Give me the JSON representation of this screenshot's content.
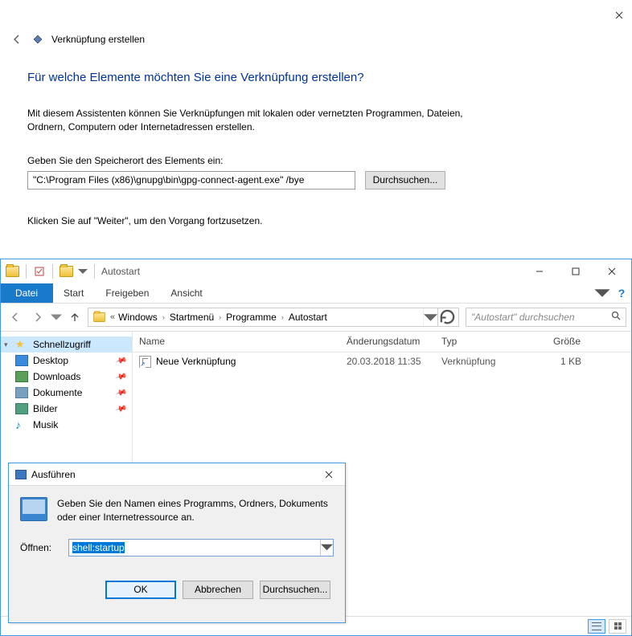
{
  "wizard": {
    "close_tip": "Schließen",
    "title": "Verknüpfung erstellen",
    "heading": "Für welche Elemente möchten Sie eine Verknüpfung erstellen?",
    "intro": "Mit diesem Assistenten können Sie Verknüpfungen mit lokalen oder vernetzten Programmen, Dateien, Ordnern, Computern oder Internetadressen erstellen.",
    "input_label": "Geben Sie den Speicherort des Elements ein:",
    "path_value": "\"C:\\Program Files (x86)\\gnupg\\bin\\gpg-connect-agent.exe\" /bye",
    "browse": "Durchsuchen...",
    "hint": "Klicken Sie auf \"Weiter\", um den Vorgang fortzusetzen."
  },
  "explorer": {
    "caption": "Autostart",
    "ribbon": {
      "file": "Datei",
      "tabs": [
        "Start",
        "Freigeben",
        "Ansicht"
      ],
      "help": "?"
    },
    "breadcrumb": [
      "Windows",
      "Startmenü",
      "Programme",
      "Autostart"
    ],
    "search_placeholder": "\"Autostart\" durchsuchen",
    "sidebar": {
      "items": [
        {
          "label": "Schnellzugriff",
          "icon": "star",
          "selected": true
        },
        {
          "label": "Desktop",
          "icon": "desk",
          "pinned": true
        },
        {
          "label": "Downloads",
          "icon": "dl",
          "pinned": true
        },
        {
          "label": "Dokumente",
          "icon": "doc",
          "pinned": true
        },
        {
          "label": "Bilder",
          "icon": "pic",
          "pinned": true
        },
        {
          "label": "Musik",
          "icon": "music"
        }
      ]
    },
    "columns": {
      "name": "Name",
      "date": "Änderungsdatum",
      "type": "Typ",
      "size": "Größe"
    },
    "rows": [
      {
        "name": "Neue Verknüpfung",
        "date": "20.03.2018 11:35",
        "type": "Verknüpfung",
        "size": "1 KB"
      }
    ]
  },
  "run": {
    "title": "Ausführen",
    "desc": "Geben Sie den Namen eines Programms, Ordners, Dokuments oder einer Internetressource an.",
    "open_label": "Öffnen:",
    "value": "shell:startup",
    "ok": "OK",
    "cancel": "Abbrechen",
    "browse": "Durchsuchen..."
  }
}
